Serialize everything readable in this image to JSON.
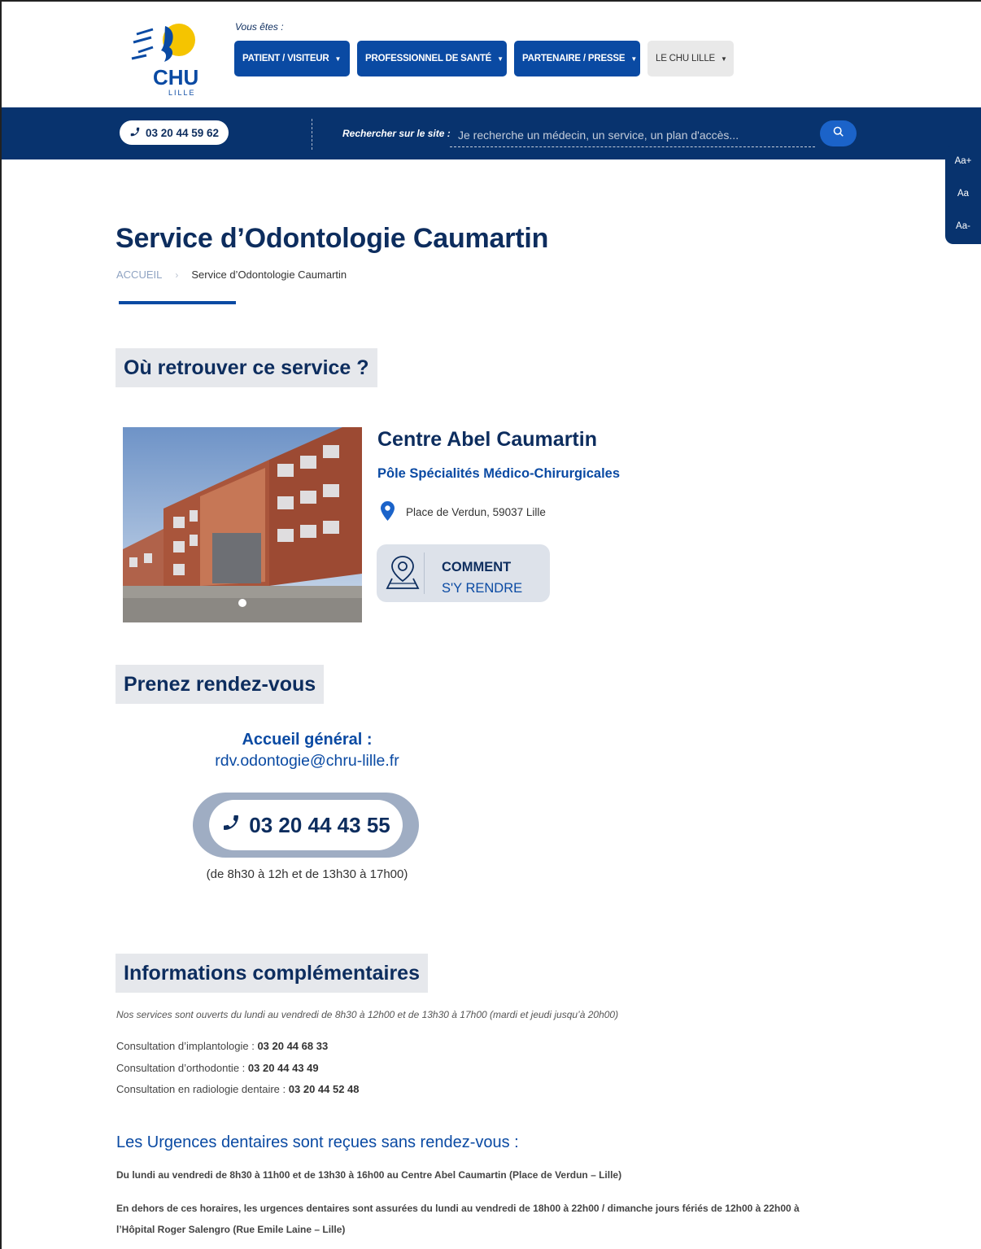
{
  "header": {
    "logo_text": "CHU",
    "logo_subtext": "LILLE",
    "vous_etes": "Vous êtes :",
    "nav": [
      {
        "label": "PATIENT / VISITEUR"
      },
      {
        "label": "PROFESSIONNEL DE SANTÉ"
      },
      {
        "label": "PARTENAIRE / PRESSE"
      },
      {
        "label": "LE CHU LILLE"
      }
    ]
  },
  "bluebar": {
    "phone": "03 20 44 59 62",
    "search_label": "Rechercher sur le site :",
    "search_placeholder": "Je recherche un médecin, un service, un plan d'accès..."
  },
  "font_controls": {
    "increase": "Aa+",
    "normal": "Aa",
    "decrease": "Aa-"
  },
  "page": {
    "title": "Service d’Odontologie Caumartin",
    "breadcrumb": {
      "home": "ACCUEIL",
      "separator": "›",
      "current": "Service d’Odontologie Caumartin"
    }
  },
  "location_section": {
    "heading": "Où retrouver ce service ?",
    "site_name": "Centre Abel Caumartin",
    "pole": "Pôle Spécialités Médico-Chirurgicales",
    "address": "Place de Verdun, 59037 Lille",
    "directions_line1": "COMMENT",
    "directions_line2": "S'Y RENDRE"
  },
  "rdv_section": {
    "heading": "Prenez rendez-vous",
    "accueil_title": "Accueil général :",
    "email": "rdv.odontogie@chru-lille.fr",
    "phone": "03 20 44 43 55",
    "hours": "(de 8h30 à 12h et de 13h30 à 17h00)"
  },
  "info_section": {
    "heading": "Informations complémentaires",
    "note": "Nos services sont ouverts du lundi au vendredi de 8h30 à 12h00 et de 13h30 à 17h00 (mardi et jeudi jusqu’à 20h00)",
    "consultations": [
      {
        "label": "Consultation d’implantologie : ",
        "phone": "03 20 44 68 33"
      },
      {
        "label": "Consultation d’orthodontie : ",
        "phone": "03 20 44 43 49"
      },
      {
        "label": "Consultation en radiologie dentaire : ",
        "phone": "03 20 44 52 48"
      }
    ],
    "urgences_title": "Les Urgences dentaires sont reçues sans rendez-vous :",
    "urgences_line1": "Du lundi au vendredi de 8h30 à 11h00 et de 13h30 à 16h00 au Centre Abel Caumartin (Place de Verdun – Lille)",
    "urgences_line2": "En dehors de ces horaires, les urgences dentaires sont assurées du lundi au vendredi de 18h00 à 22h00  / dimanche jours fériés de 12h00 à 22h00 à",
    "urgences_line3": "l’Hôpital Roger Salengro (Rue Emile Laine – Lille)"
  },
  "colors": {
    "navy": "#0d2d5e",
    "primary_blue": "#0a4aa3",
    "bar_blue": "#08336e",
    "logo_yellow": "#f5c400",
    "heading_bg": "#e6e8ec"
  }
}
